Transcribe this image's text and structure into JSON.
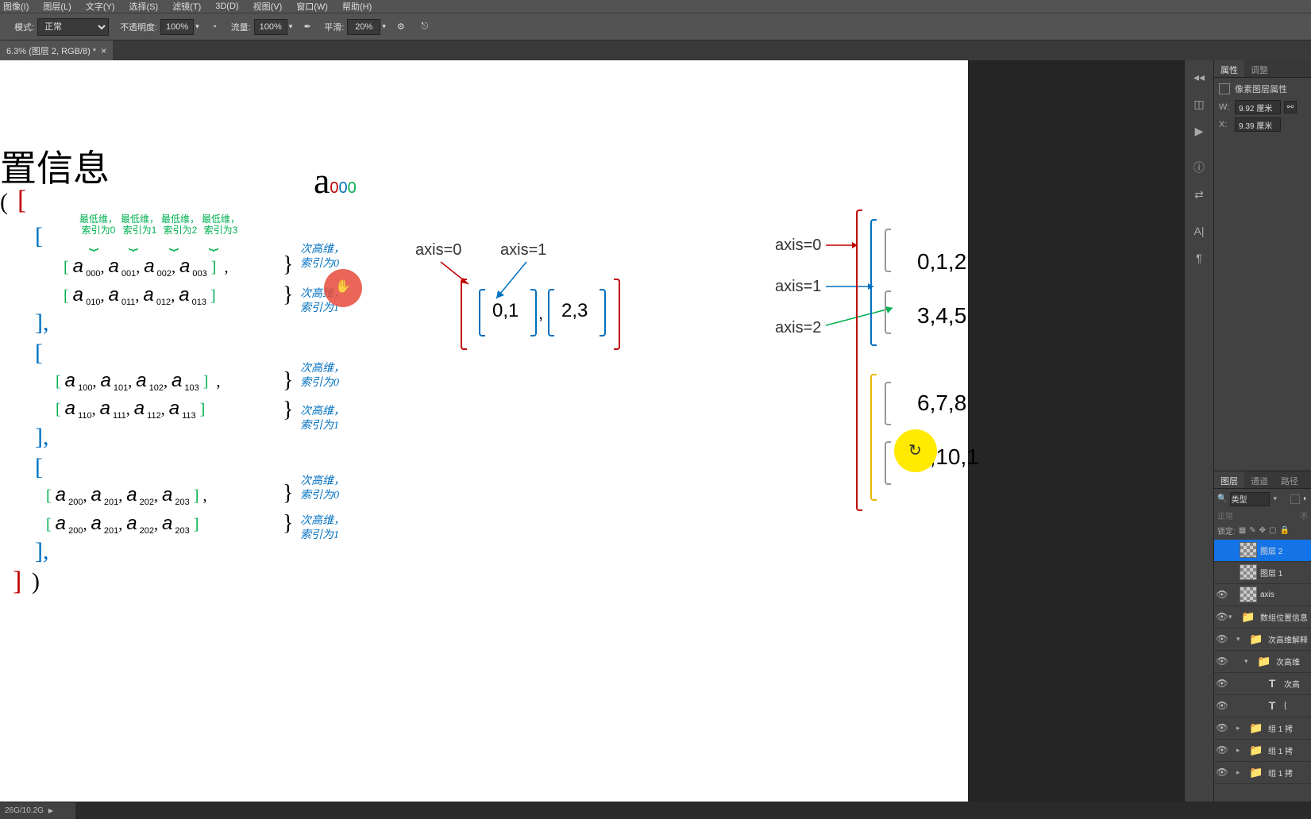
{
  "menu": {
    "items": [
      "图像(I)",
      "图层(L)",
      "文字(Y)",
      "选择(S)",
      "滤镜(T)",
      "3D(D)",
      "视图(V)",
      "窗口(W)",
      "帮助(H)"
    ]
  },
  "options": {
    "mode_label": "模式:",
    "mode_value": "正常",
    "opacity_label": "不透明度:",
    "opacity_value": "100%",
    "flow_label": "流量:",
    "flow_value": "100%",
    "smoothing_label": "平滑:",
    "smoothing_value": "20%"
  },
  "tab": {
    "title": "6.3% (图层 2, RGB/8) *"
  },
  "canvas": {
    "title": "置信息",
    "a_main": "a",
    "a_sub1": "0",
    "a_sub2": "0",
    "a_sub3": "0",
    "top_labels": [
      "最低维，\n索引为0",
      "最低维，\n索引为1",
      "最低维，\n索引为2",
      "最低维，\n索引为3"
    ],
    "secondary_labels": [
      "次高维，\n索引为0",
      "次高维，\n索引为1",
      "次高维，\n索引为0",
      "次高维，\n索引为1",
      "次高维，\n索引为0",
      "次高维，\n索引为1"
    ],
    "rows": [
      {
        "b": "[ ",
        "items": [
          "a 000,",
          "a 001,",
          "a 002,",
          "a 003"
        ],
        "e": " ]",
        "tail": ","
      },
      {
        "b": "[ ",
        "items": [
          "a 010,",
          "a 011,",
          "a 012,",
          "a 013"
        ],
        "e": " ]",
        "tail": ""
      },
      {
        "b": "[ ",
        "items": [
          "a 100,",
          "a 101,",
          "a 102,",
          "a 103"
        ],
        "e": " ]",
        "tail": ","
      },
      {
        "b": "[ ",
        "items": [
          "a 110,",
          "a 111,",
          "a 112,",
          "a 113"
        ],
        "e": " ]",
        "tail": ""
      },
      {
        "b": "[ ",
        "items": [
          "a 200,",
          "a 201,",
          "a 202,",
          "a 203"
        ],
        "e": " ]",
        "tail": ","
      },
      {
        "b": "[ ",
        "items": [
          "a 200,",
          "a 201,",
          "a 202,",
          "a 203"
        ],
        "e": " ]",
        "tail": ""
      }
    ],
    "axis2d_0": "axis=0",
    "axis2d_1": "axis=1",
    "cells2d": [
      "0,1",
      "2,3"
    ],
    "axis3d_0": "axis=0",
    "axis3d_1": "axis=1",
    "axis3d_2": "axis=2",
    "cells3d": [
      "0,1,2",
      "3,4,5",
      "6,7,8",
      "9,10,1"
    ]
  },
  "props_panel": {
    "tab_props": "属性",
    "tab_adjust": "调整",
    "header": "像素图层属性",
    "w_label": "W:",
    "w_value": "9.92 厘米",
    "x_label": "X:",
    "x_value": "9.39 厘米"
  },
  "layers_panel": {
    "tab_layers": "图层",
    "tab_channels": "通道",
    "tab_paths": "路径",
    "kind_label": "类型",
    "blend_value": "正常",
    "opacity_suffix": "不",
    "lock_label": "锁定:",
    "layers": [
      {
        "name": "图层 2",
        "type": "raster-checker",
        "selected": true,
        "eye": false,
        "indent": 0
      },
      {
        "name": "图层 1",
        "type": "raster-checker",
        "eye": false,
        "indent": 0
      },
      {
        "name": "axis",
        "type": "raster-checker",
        "eye": true,
        "indent": 0
      },
      {
        "name": "数组位置信息",
        "type": "folder",
        "eye": true,
        "indent": 0,
        "caret": "v"
      },
      {
        "name": "次高维解释",
        "type": "folder",
        "eye": true,
        "indent": 1,
        "caret": "v"
      },
      {
        "name": "次高维",
        "type": "folder",
        "eye": true,
        "indent": 2,
        "caret": "v"
      },
      {
        "name": "次高",
        "type": "text",
        "eye": true,
        "indent": 3
      },
      {
        "name": "{",
        "type": "text",
        "eye": true,
        "indent": 3
      },
      {
        "name": "组 1 拷",
        "type": "folder",
        "eye": true,
        "indent": 1,
        "caret": ">"
      },
      {
        "name": "组 1 拷",
        "type": "folder",
        "eye": true,
        "indent": 1,
        "caret": ">"
      },
      {
        "name": "组 1 拷",
        "type": "folder",
        "eye": true,
        "indent": 1,
        "caret": ">"
      }
    ]
  },
  "status": {
    "text": "26G/10.2G"
  }
}
